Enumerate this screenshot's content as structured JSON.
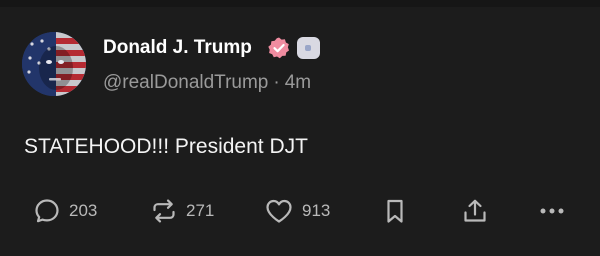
{
  "post": {
    "author": {
      "display_name": "Donald J. Trump",
      "handle": "@realDonaldTrump",
      "separator": "·",
      "time": "4m",
      "verified_badge_color": "#f08ca0",
      "avatar": "american-flag-face-portrait"
    },
    "text": "STATEHOOD!!! President DJT",
    "actions": {
      "replies": {
        "icon": "comment-icon",
        "count": "203"
      },
      "reposts": {
        "icon": "repost-icon",
        "count": "271"
      },
      "likes": {
        "icon": "heart-icon",
        "count": "913"
      },
      "bookmark": {
        "icon": "bookmark-icon"
      },
      "share": {
        "icon": "share-icon"
      },
      "more": {
        "icon": "more-icon"
      }
    }
  },
  "colors": {
    "background": "#1c1c1c",
    "text_primary": "#ffffff",
    "text_secondary": "#9a9a9a",
    "icon": "#b9b9b9"
  }
}
